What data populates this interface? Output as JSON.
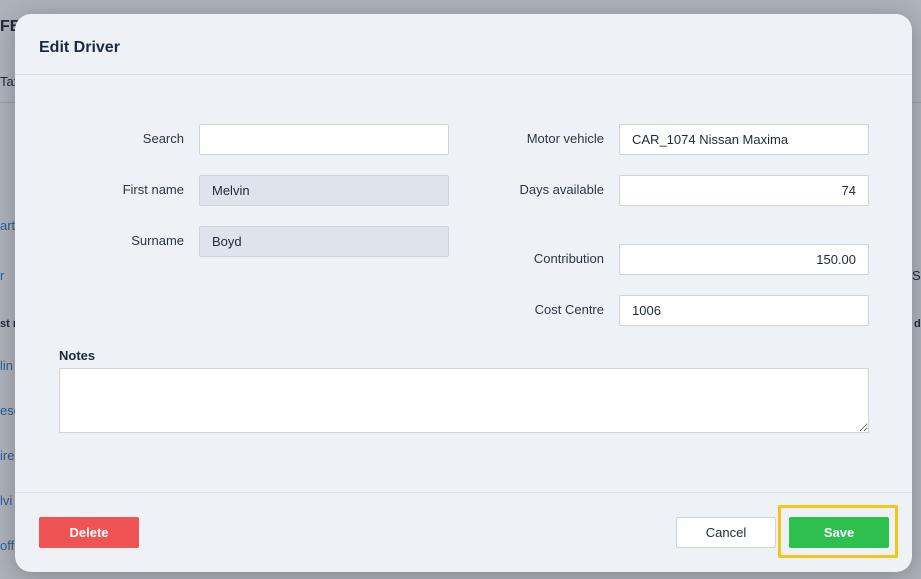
{
  "background": {
    "frag_top": "FB",
    "frag_tax": "Tax",
    "frag_art": "art",
    "frag_r": "r",
    "frag_st": "st n",
    "frag_lin": "lin",
    "frag_esc": "esc",
    "frag_ire": "ire",
    "frag_lvi": "lvi",
    "frag_off": "off",
    "frag_se": "Se",
    "frag_d": "d"
  },
  "modal": {
    "title": "Edit Driver",
    "fields": {
      "search": {
        "label": "Search",
        "value": ""
      },
      "first_name": {
        "label": "First name",
        "value": "Melvin"
      },
      "surname": {
        "label": "Surname",
        "value": "Boyd"
      },
      "motor_vehicle": {
        "label": "Motor vehicle",
        "value": "CAR_1074 Nissan Maxima"
      },
      "days_available": {
        "label": "Days available",
        "value": "74"
      },
      "contribution": {
        "label": "Contribution",
        "value": "150.00"
      },
      "cost_centre": {
        "label": "Cost Centre",
        "value": "1006"
      }
    },
    "notes": {
      "label": "Notes",
      "value": ""
    },
    "buttons": {
      "delete": "Delete",
      "cancel": "Cancel",
      "save": "Save"
    }
  },
  "colors": {
    "delete": "#ef5353",
    "save": "#2dc04f",
    "highlight": "#f5c518"
  }
}
